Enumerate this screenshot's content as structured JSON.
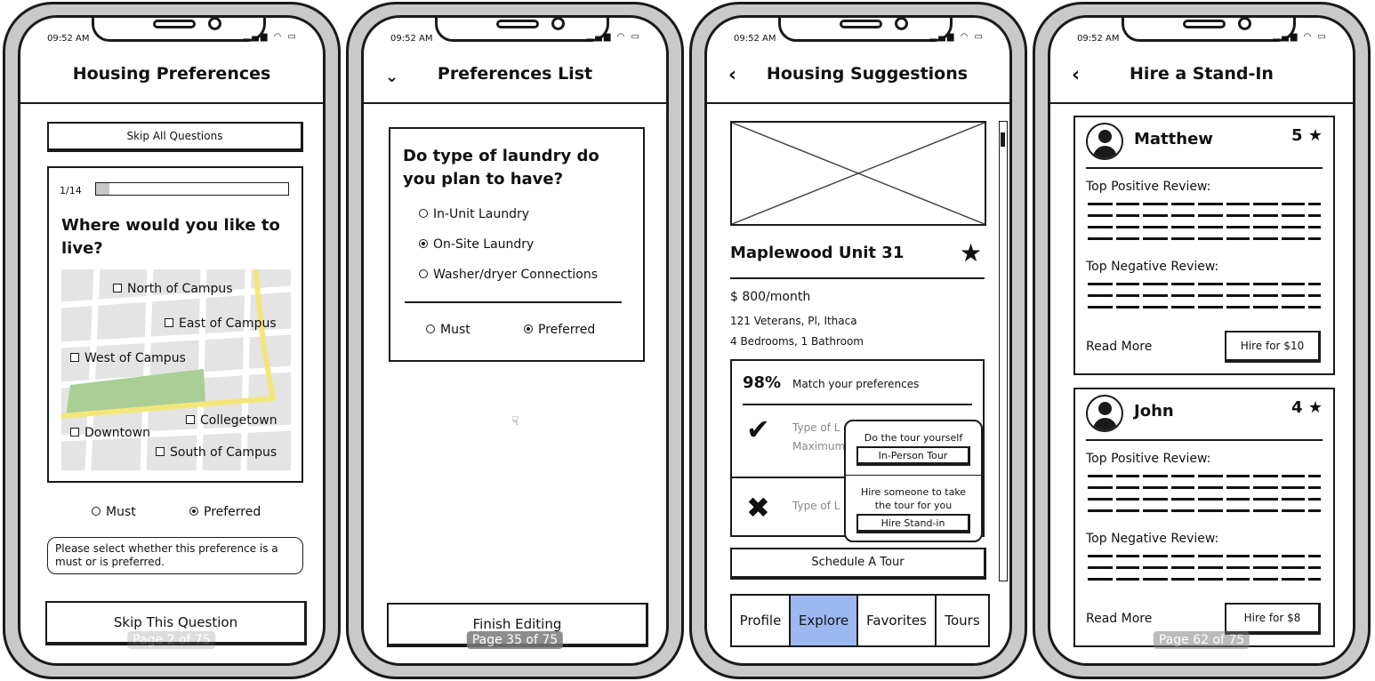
{
  "status": {
    "time": "09:52 AM",
    "icons": "▂▄▆ ◠ ▭"
  },
  "screen1": {
    "title": "Housing Preferences",
    "skip_all": "Skip All Questions",
    "progress": {
      "label": "1/14",
      "fraction": 0.07
    },
    "question": "Where would you like to live?",
    "map_options": [
      "North of Campus",
      "East of Campus",
      "West of Campus",
      "Collegetown",
      "Downtown",
      "South of Campus"
    ],
    "must": "Must",
    "preferred": "Preferred",
    "hint": "Please select whether this preference is a must or is preferred.",
    "skip_this": "Skip This Question",
    "page": "Page 2 of 75"
  },
  "screen2": {
    "title": "Preferences List",
    "question": "Do type of laundry do you plan to have?",
    "options": [
      "In-Unit Laundry",
      "On-Site Laundry",
      "Washer/dryer Connections"
    ],
    "selected_option": 1,
    "must": "Must",
    "preferred": "Preferred",
    "finish": "Finish Editing",
    "page": "Page 35 of 75"
  },
  "screen3": {
    "title": "Housing Suggestions",
    "listing_name": "Maplewood Unit 31",
    "price": "$ 800/month",
    "address": "121 Veterans, Pl, Ithaca",
    "rooms": "4 Bedrooms, 1 Bathroom",
    "match_pct": "98%",
    "match_label": "Match your preferences",
    "row1_text": "Type of L",
    "row1_sub": "Maximum",
    "row2_text": "Type of L",
    "popup": {
      "self_label": "Do the tour yourself",
      "in_person": "In-Person Tour",
      "hire_label": "Hire someone to take the tour for you",
      "hire_btn": "Hire Stand-in"
    },
    "schedule": "Schedule A Tour",
    "tabs": [
      "Profile",
      "Explore",
      "Favorites",
      "Tours"
    ],
    "active_tab": "Explore",
    "accent": "#9bb8f0"
  },
  "screen4": {
    "title": "Hire a Stand-In",
    "cards": [
      {
        "name": "Matthew",
        "rating": "5",
        "pos": "Top Positive Review:",
        "neg": "Top Negative Review:",
        "more": "Read More",
        "hire": "Hire for $10"
      },
      {
        "name": "John",
        "rating": "4",
        "pos": "Top Positive Review:",
        "neg": "Top Negative Review:",
        "more": "Read More",
        "hire": "Hire for $8"
      }
    ],
    "page": "Page 62 of 75"
  }
}
